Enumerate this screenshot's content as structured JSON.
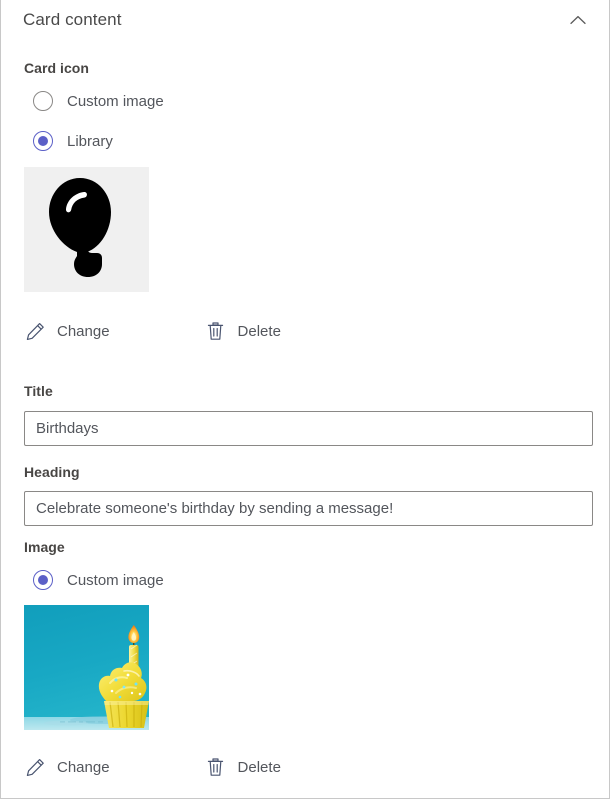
{
  "panel": {
    "title": "Card content",
    "collapse_icon": "chevron-up-icon"
  },
  "card_icon_section": {
    "label": "Card icon",
    "options": [
      {
        "label": "Custom image",
        "selected": false
      },
      {
        "label": "Library",
        "selected": true
      }
    ],
    "preview": {
      "icon": "balloon-icon",
      "background": "#f0f0f0"
    },
    "actions": [
      {
        "label": "Change",
        "icon": "pencil-icon"
      },
      {
        "label": "Delete",
        "icon": "trash-icon"
      }
    ]
  },
  "title_field": {
    "label": "Title",
    "value": "Birthdays",
    "placeholder": "Title"
  },
  "heading_field": {
    "label": "Heading",
    "value": "Celebrate someone's birthday by sending a message!",
    "placeholder": "Heading"
  },
  "image_section": {
    "label": "Image",
    "options": [
      {
        "label": "Custom image",
        "selected": true
      }
    ],
    "preview": {
      "icon": "cupcake-photo",
      "description": "Yellow cupcake with lit candle on teal background",
      "background": "#17a5c0"
    },
    "actions": [
      {
        "label": "Change",
        "icon": "pencil-icon"
      },
      {
        "label": "Delete",
        "icon": "trash-icon"
      }
    ]
  },
  "colors": {
    "accent": "#5b5fc7",
    "text": "#53565c",
    "label_text": "#484644",
    "title_text": "#4a4a4a",
    "border": "#8a8886",
    "panel_border": "#c8c8c8",
    "thumb_background": "#f0f0f0",
    "photo_teal": "#17a5c0",
    "photo_yellow": "#f2dd3a"
  }
}
